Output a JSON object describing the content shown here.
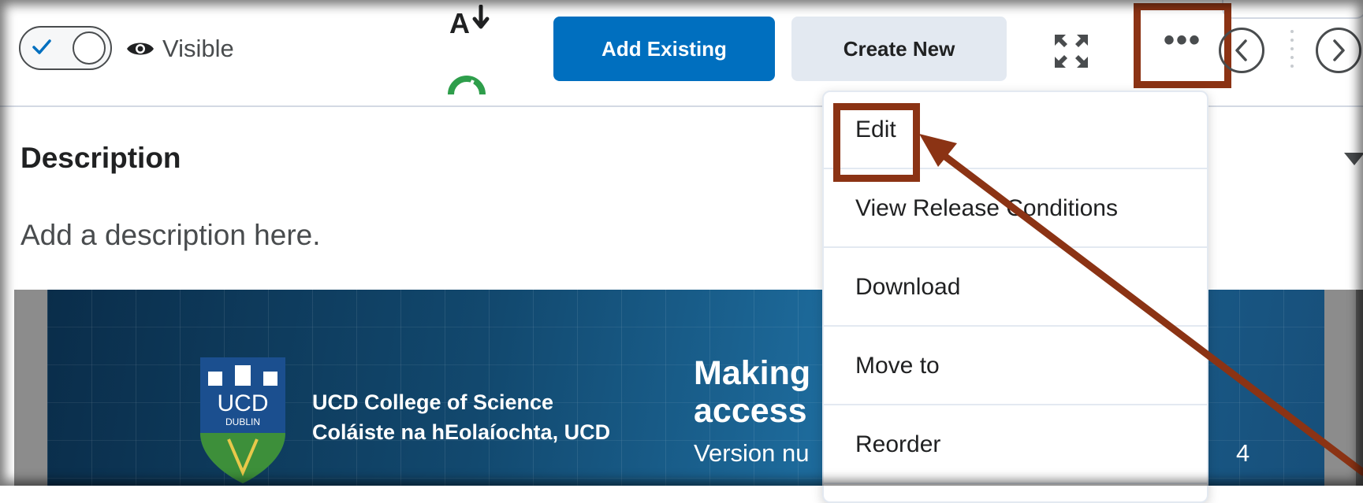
{
  "toolbar": {
    "visibility_toggle_checked": true,
    "visibility_label": "Visible",
    "add_existing_label": "Add Existing",
    "create_new_label": "Create New",
    "more_actions_glyph": "•••",
    "icons": [
      "check-icon",
      "eye-icon",
      "sort-a-icon",
      "gauge-icon",
      "expand-icon",
      "more-icon",
      "chevron-left-icon",
      "chevron-right-icon"
    ],
    "colors": {
      "primary": "#006fbf",
      "secondary": "#e3e9f1",
      "annotation": "#8b3314",
      "gauge": "#2e9e4b"
    }
  },
  "description": {
    "heading": "Description",
    "placeholder_text": "Add a description here."
  },
  "menu": {
    "items": [
      {
        "label": "Edit"
      },
      {
        "label": "View Release Conditions"
      },
      {
        "label": "Download"
      },
      {
        "label": "Move to"
      },
      {
        "label": "Reorder"
      }
    ]
  },
  "banner": {
    "crest_text": "UCD",
    "crest_subtext": "DUBLIN",
    "college_line1": "UCD College of Science",
    "college_line2": "Coláiste na hEolaíochta, UCD",
    "title_line1": "Making",
    "title_line2": "access",
    "version_text": "Version nu",
    "version_suffix": "4"
  }
}
